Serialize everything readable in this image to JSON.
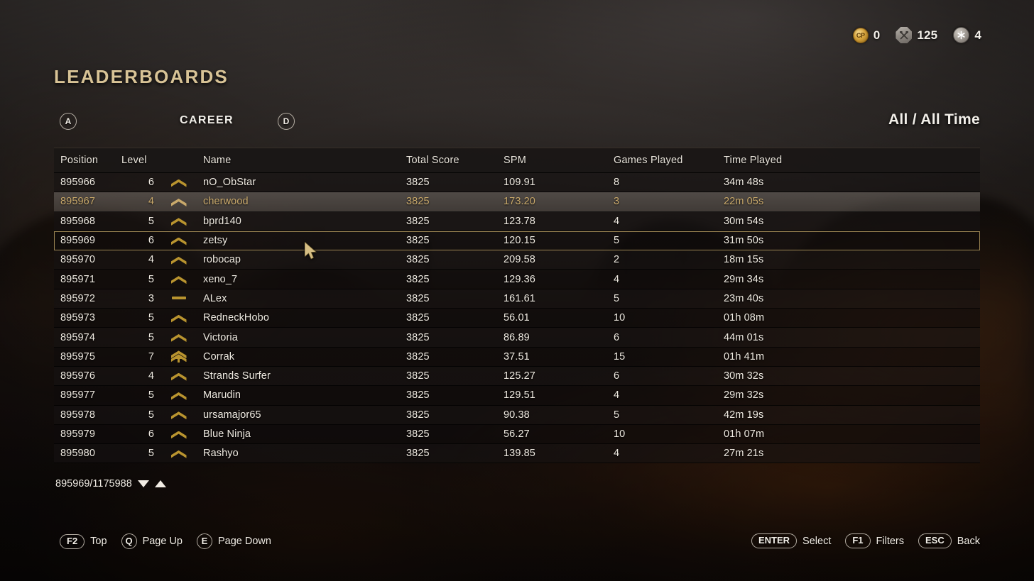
{
  "hud": {
    "items": [
      {
        "icon": "cp-coin-icon",
        "label": "CP",
        "value": "0"
      },
      {
        "icon": "crossed-hammers-icon",
        "value": "125"
      },
      {
        "icon": "screw-star-icon",
        "value": "4"
      }
    ]
  },
  "header": {
    "title": "LEADERBOARDS",
    "prev_key": "A",
    "next_key": "D",
    "tab": "CAREER",
    "filter": "All / All Time"
  },
  "table": {
    "columns": [
      "Position",
      "Level",
      "Name",
      "Total Score",
      "SPM",
      "Games Played",
      "Time Played"
    ],
    "rows": [
      {
        "position": "895966",
        "level": "6",
        "rank": "chevron",
        "name": "nO_ObStar",
        "score": "3825",
        "spm": "109.91",
        "games": "8",
        "time": "34m 48s",
        "state": "normal"
      },
      {
        "position": "895967",
        "level": "4",
        "rank": "chevron",
        "name": "cherwood",
        "score": "3825",
        "spm": "173.20",
        "games": "3",
        "time": "22m 05s",
        "state": "highlight"
      },
      {
        "position": "895968",
        "level": "5",
        "rank": "chevron",
        "name": "bprd140",
        "score": "3825",
        "spm": "123.78",
        "games": "4",
        "time": "30m 54s",
        "state": "normal"
      },
      {
        "position": "895969",
        "level": "6",
        "rank": "chevron",
        "name": "zetsy",
        "score": "3825",
        "spm": "120.15",
        "games": "5",
        "time": "31m 50s",
        "state": "selected"
      },
      {
        "position": "895970",
        "level": "4",
        "rank": "chevron",
        "name": "robocap",
        "score": "3825",
        "spm": "209.58",
        "games": "2",
        "time": "18m 15s",
        "state": "normal"
      },
      {
        "position": "895971",
        "level": "5",
        "rank": "chevron",
        "name": "xeno_7",
        "score": "3825",
        "spm": "129.36",
        "games": "4",
        "time": "29m 34s",
        "state": "normal"
      },
      {
        "position": "895972",
        "level": "3",
        "rank": "bar",
        "name": "ALex",
        "score": "3825",
        "spm": "161.61",
        "games": "5",
        "time": "23m 40s",
        "state": "normal"
      },
      {
        "position": "895973",
        "level": "5",
        "rank": "chevron",
        "name": "RedneckHobo",
        "score": "3825",
        "spm": "56.01",
        "games": "10",
        "time": "01h 08m",
        "state": "normal"
      },
      {
        "position": "895974",
        "level": "5",
        "rank": "chevron",
        "name": "Victoria",
        "score": "3825",
        "spm": "86.89",
        "games": "6",
        "time": "44m 01s",
        "state": "normal"
      },
      {
        "position": "895975",
        "level": "7",
        "rank": "double-chevron",
        "name": "Corrak",
        "score": "3825",
        "spm": "37.51",
        "games": "15",
        "time": "01h 41m",
        "state": "normal"
      },
      {
        "position": "895976",
        "level": "4",
        "rank": "chevron",
        "name": "Strands Surfer",
        "score": "3825",
        "spm": "125.27",
        "games": "6",
        "time": "30m 32s",
        "state": "normal"
      },
      {
        "position": "895977",
        "level": "5",
        "rank": "chevron",
        "name": "Marudin",
        "score": "3825",
        "spm": "129.51",
        "games": "4",
        "time": "29m 32s",
        "state": "normal"
      },
      {
        "position": "895978",
        "level": "5",
        "rank": "chevron",
        "name": "ursamajor65",
        "score": "3825",
        "spm": "90.38",
        "games": "5",
        "time": "42m 19s",
        "state": "normal"
      },
      {
        "position": "895979",
        "level": "6",
        "rank": "chevron",
        "name": "Blue Ninja",
        "score": "3825",
        "spm": "56.27",
        "games": "10",
        "time": "01h 07m",
        "state": "normal"
      },
      {
        "position": "895980",
        "level": "5",
        "rank": "chevron",
        "name": "Rashyo",
        "score": "3825",
        "spm": "139.85",
        "games": "4",
        "time": "27m 21s",
        "state": "normal"
      }
    ]
  },
  "pagination": {
    "text": "895969/1175988"
  },
  "footer": {
    "left": [
      {
        "key": "F2",
        "shape": "rect",
        "label": "Top"
      },
      {
        "key": "Q",
        "shape": "round",
        "label": "Page Up"
      },
      {
        "key": "E",
        "shape": "round",
        "label": "Page Down"
      }
    ],
    "right": [
      {
        "key": "ENTER",
        "shape": "rect",
        "label": "Select"
      },
      {
        "key": "F1",
        "shape": "rect",
        "label": "Filters"
      },
      {
        "key": "ESC",
        "shape": "rect",
        "label": "Back"
      }
    ]
  },
  "colors": {
    "accent_gold": "#d8c396",
    "insignia_gold": "#b9942f",
    "highlight_text": "#c9a96b",
    "text_primary": "#efeae1",
    "selection_outline": "#9c8653"
  }
}
